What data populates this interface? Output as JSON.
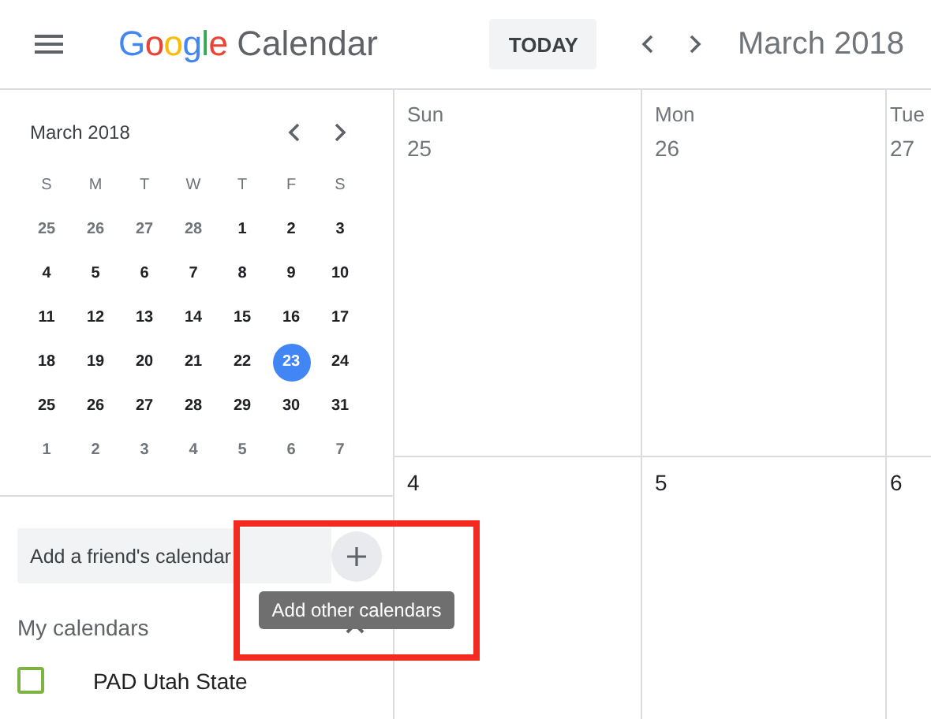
{
  "header": {
    "logo": "Google",
    "app_name": "Calendar",
    "today_button": "TODAY",
    "period": "March 2018"
  },
  "mini_calendar": {
    "title": "March 2018",
    "weekdays": [
      "S",
      "M",
      "T",
      "W",
      "T",
      "F",
      "S"
    ],
    "weeks": [
      [
        {
          "day": "25",
          "muted": true,
          "selected": false
        },
        {
          "day": "26",
          "muted": true,
          "selected": false
        },
        {
          "day": "27",
          "muted": true,
          "selected": false
        },
        {
          "day": "28",
          "muted": true,
          "selected": false
        },
        {
          "day": "1",
          "muted": false,
          "selected": false
        },
        {
          "day": "2",
          "muted": false,
          "selected": false
        },
        {
          "day": "3",
          "muted": false,
          "selected": false
        }
      ],
      [
        {
          "day": "4",
          "muted": false,
          "selected": false
        },
        {
          "day": "5",
          "muted": false,
          "selected": false
        },
        {
          "day": "6",
          "muted": false,
          "selected": false
        },
        {
          "day": "7",
          "muted": false,
          "selected": false
        },
        {
          "day": "8",
          "muted": false,
          "selected": false
        },
        {
          "day": "9",
          "muted": false,
          "selected": false
        },
        {
          "day": "10",
          "muted": false,
          "selected": false
        }
      ],
      [
        {
          "day": "11",
          "muted": false,
          "selected": false
        },
        {
          "day": "12",
          "muted": false,
          "selected": false
        },
        {
          "day": "13",
          "muted": false,
          "selected": false
        },
        {
          "day": "14",
          "muted": false,
          "selected": false
        },
        {
          "day": "15",
          "muted": false,
          "selected": false
        },
        {
          "day": "16",
          "muted": false,
          "selected": false
        },
        {
          "day": "17",
          "muted": false,
          "selected": false
        }
      ],
      [
        {
          "day": "18",
          "muted": false,
          "selected": false
        },
        {
          "day": "19",
          "muted": false,
          "selected": false
        },
        {
          "day": "20",
          "muted": false,
          "selected": false
        },
        {
          "day": "21",
          "muted": false,
          "selected": false
        },
        {
          "day": "22",
          "muted": false,
          "selected": false
        },
        {
          "day": "23",
          "muted": false,
          "selected": true
        },
        {
          "day": "24",
          "muted": false,
          "selected": false
        }
      ],
      [
        {
          "day": "25",
          "muted": false,
          "selected": false
        },
        {
          "day": "26",
          "muted": false,
          "selected": false
        },
        {
          "day": "27",
          "muted": false,
          "selected": false
        },
        {
          "day": "28",
          "muted": false,
          "selected": false
        },
        {
          "day": "29",
          "muted": false,
          "selected": false
        },
        {
          "day": "30",
          "muted": false,
          "selected": false
        },
        {
          "day": "31",
          "muted": false,
          "selected": false
        }
      ],
      [
        {
          "day": "1",
          "muted": true,
          "selected": false
        },
        {
          "day": "2",
          "muted": true,
          "selected": false
        },
        {
          "day": "3",
          "muted": true,
          "selected": false
        },
        {
          "day": "4",
          "muted": true,
          "selected": false
        },
        {
          "day": "5",
          "muted": true,
          "selected": false
        },
        {
          "day": "6",
          "muted": true,
          "selected": false
        },
        {
          "day": "7",
          "muted": true,
          "selected": false
        }
      ]
    ]
  },
  "friend_field": {
    "placeholder": "Add a friend's calendar"
  },
  "tooltip": "Add other calendars",
  "my_calendars": {
    "title": "My calendars",
    "expanded": true,
    "items": [
      {
        "name": "PAD Utah State",
        "checked": false,
        "color": "#7cb342"
      }
    ]
  },
  "grid": {
    "columns": [
      {
        "weekday": "Sun",
        "date": "25"
      },
      {
        "weekday": "Mon",
        "date": "26"
      },
      {
        "weekday": "Tue",
        "date": "27"
      }
    ],
    "second_row": [
      "4",
      "5",
      "6"
    ]
  },
  "annotation": {
    "kind": "highlight"
  }
}
